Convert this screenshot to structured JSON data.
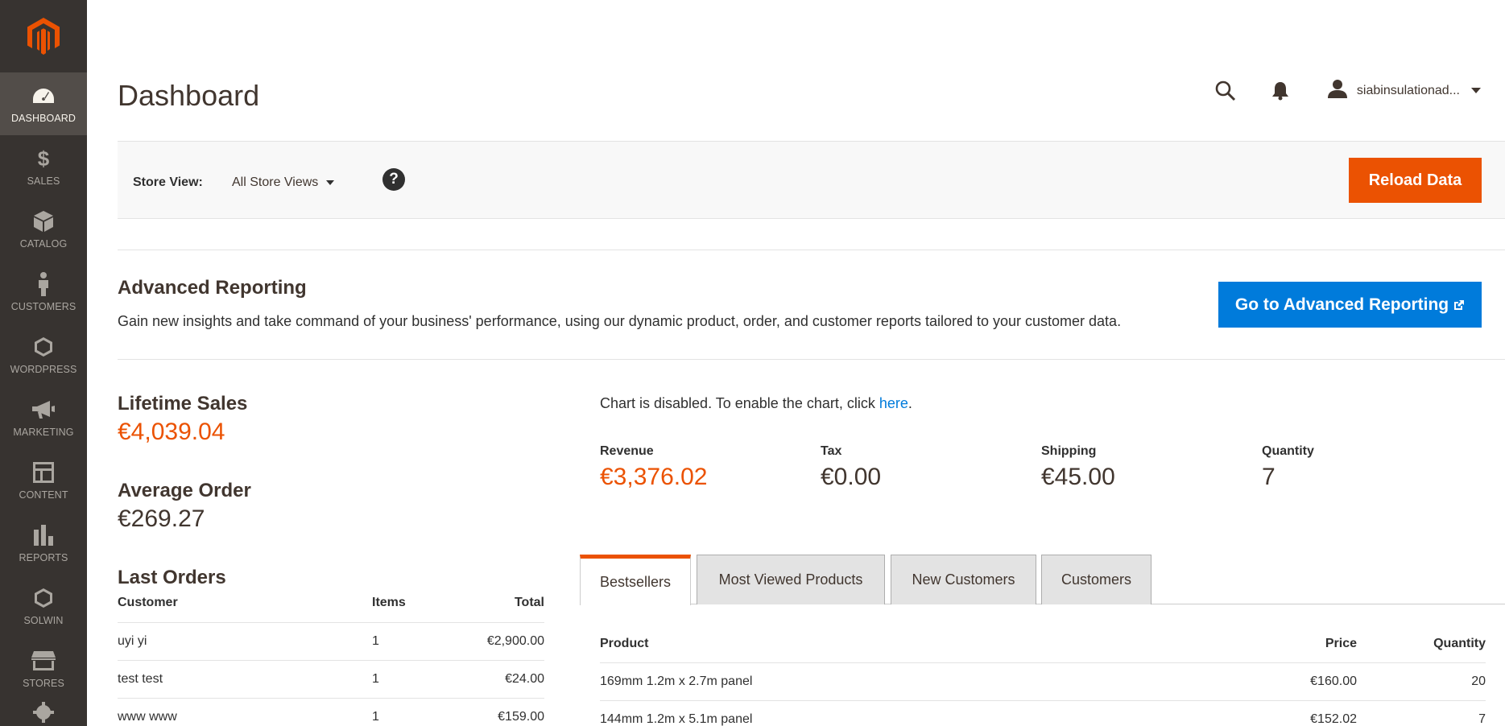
{
  "sidebar": {
    "logo": "magento-logo",
    "items": [
      {
        "label": "DASHBOARD",
        "icon": "dashboard-icon",
        "active": true
      },
      {
        "label": "SALES",
        "icon": "dollar-icon"
      },
      {
        "label": "CATALOG",
        "icon": "box-icon"
      },
      {
        "label": "CUSTOMERS",
        "icon": "person-icon"
      },
      {
        "label": "WORDPRESS",
        "icon": "hexagon-icon"
      },
      {
        "label": "MARKETING",
        "icon": "megaphone-icon"
      },
      {
        "label": "CONTENT",
        "icon": "layout-icon"
      },
      {
        "label": "REPORTS",
        "icon": "bar-chart-icon"
      },
      {
        "label": "SOLWIN",
        "icon": "hexagon-icon"
      },
      {
        "label": "STORES",
        "icon": "store-icon"
      }
    ]
  },
  "header": {
    "title": "Dashboard",
    "user": "siabinsulationad..."
  },
  "store_view": {
    "label": "Store View:",
    "selected": "All Store Views",
    "help": "?",
    "reload_label": "Reload Data"
  },
  "advanced_reporting": {
    "title": "Advanced Reporting",
    "description": "Gain new insights and take command of your business' performance, using our dynamic product, order, and customer reports tailored to your customer data.",
    "button_label": "Go to Advanced Reporting"
  },
  "stats": {
    "lifetime_label": "Lifetime Sales",
    "lifetime_value": "€4,039.04",
    "average_label": "Average Order",
    "average_value": "€269.27"
  },
  "last_orders": {
    "title": "Last Orders",
    "headers": [
      "Customer",
      "Items",
      "Total"
    ],
    "rows": [
      {
        "customer": "uyi yi",
        "items": "1",
        "total": "€2,900.00"
      },
      {
        "customer": "test test",
        "items": "1",
        "total": "€24.00"
      },
      {
        "customer": "www www",
        "items": "1",
        "total": "€159.00"
      }
    ]
  },
  "chart": {
    "note": "Chart is disabled. To enable the chart, click ",
    "link": "here",
    "end": "."
  },
  "totals": [
    {
      "label": "Revenue",
      "value": "€3,376.02",
      "accent": "#eb5202"
    },
    {
      "label": "Tax",
      "value": "€0.00"
    },
    {
      "label": "Shipping",
      "value": "€45.00"
    },
    {
      "label": "Quantity",
      "value": "7"
    }
  ],
  "tabs": [
    "Bestsellers",
    "Most Viewed Products",
    "New Customers",
    "Customers"
  ],
  "products": {
    "headers": [
      "Product",
      "Price",
      "Quantity"
    ],
    "rows": [
      {
        "product": "169mm 1.2m x 2.7m panel",
        "price": "€160.00",
        "qty": "20"
      },
      {
        "product": "144mm 1.2m x 5.1m panel",
        "price": "€152.02",
        "qty": "7"
      }
    ]
  },
  "colors": {
    "accent": "#eb5202",
    "link": "#007bdb",
    "sidebar": "#373330"
  }
}
